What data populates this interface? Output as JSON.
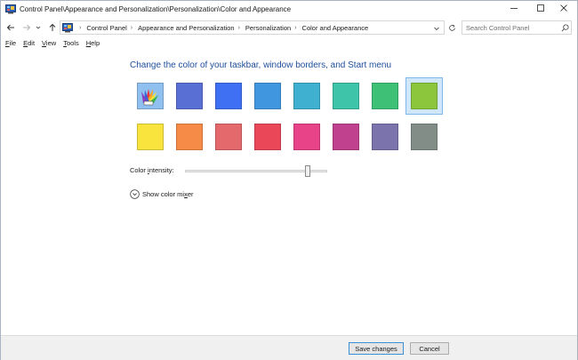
{
  "window": {
    "title": "Control Panel\\Appearance and Personalization\\Personalization\\Color and Appearance",
    "controls": {
      "minimize": "—",
      "maximize": "☐",
      "close": "✕"
    }
  },
  "nav": {
    "back_icon": "arrow-left-icon",
    "forward_icon": "arrow-right-icon",
    "recent_icon": "chevron-down-icon",
    "up_icon": "arrow-up-icon",
    "breadcrumbs": [
      "Control Panel",
      "Appearance and Personalization",
      "Personalization",
      "Color and Appearance"
    ],
    "search": {
      "placeholder": "Search Control Panel",
      "value": ""
    }
  },
  "menu": {
    "items": [
      {
        "accel": "F",
        "rest": "ile"
      },
      {
        "accel": "E",
        "rest": "dit"
      },
      {
        "accel": "V",
        "rest": "iew"
      },
      {
        "accel": "T",
        "rest": "ools"
      },
      {
        "accel": "H",
        "rest": "elp"
      }
    ]
  },
  "main": {
    "heading": "Change the color of your taskbar, window borders, and Start menu",
    "colors": [
      {
        "name": "automatic",
        "hex": ""
      },
      {
        "name": "indigo",
        "hex": "#5a6fd4"
      },
      {
        "name": "blue",
        "hex": "#3f6ff2"
      },
      {
        "name": "sky",
        "hex": "#4196e0"
      },
      {
        "name": "teal",
        "hex": "#3fb0cf"
      },
      {
        "name": "turquoise",
        "hex": "#3ec4a8"
      },
      {
        "name": "green",
        "hex": "#3ec177"
      },
      {
        "name": "lime",
        "hex": "#8cc63c",
        "selected": true
      },
      {
        "name": "yellow",
        "hex": "#f8e43c"
      },
      {
        "name": "orange",
        "hex": "#f68b47"
      },
      {
        "name": "salmon",
        "hex": "#e3696c"
      },
      {
        "name": "red",
        "hex": "#ea4759"
      },
      {
        "name": "pink",
        "hex": "#e84289"
      },
      {
        "name": "magenta",
        "hex": "#c0418e"
      },
      {
        "name": "lavender",
        "hex": "#7a73ac"
      },
      {
        "name": "gray",
        "hex": "#838d87"
      }
    ],
    "intensity": {
      "label_pre": "Color ",
      "label_accel": "i",
      "label_post": "ntensity:",
      "value_fraction": 0.86
    },
    "mixer": {
      "label_pre": "Show color mi",
      "label_accel": "x",
      "label_post": "er"
    }
  },
  "footer": {
    "save_label": "Save changes",
    "cancel_label": "Cancel"
  }
}
